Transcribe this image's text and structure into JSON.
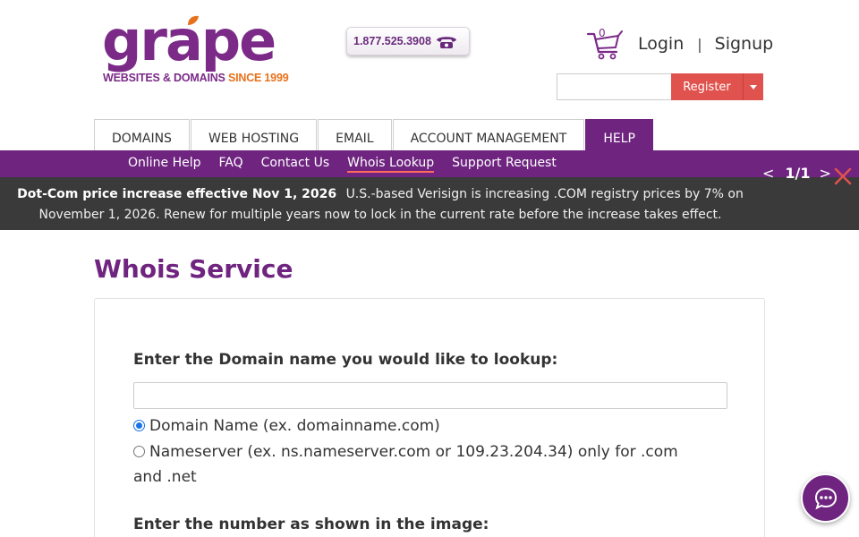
{
  "brand": {
    "logo_word": "grape",
    "tagline_part1": "WEBSITES & DOMAINS",
    "tagline_part2": " SINCE 1999",
    "color_purple": "#7b2a88",
    "color_orange": "#e8711b"
  },
  "header": {
    "phone": "1.877.525.3908",
    "phone_icon": "telephone-icon",
    "cart_count": "0",
    "cart_icon": "shopping-cart-icon",
    "login_label": "Login",
    "separator": "|",
    "signup_label": "Signup",
    "register_input_value": "",
    "register_button_label": "Register",
    "register_accent": "#e0524d"
  },
  "nav": {
    "tabs": [
      {
        "label": "DOMAINS",
        "active": false
      },
      {
        "label": "WEB HOSTING",
        "active": false
      },
      {
        "label": "EMAIL",
        "active": false
      },
      {
        "label": "ACCOUNT MANAGEMENT",
        "active": false
      },
      {
        "label": "HELP",
        "active": true
      }
    ],
    "accent": "#6f2480"
  },
  "subnav": {
    "items": [
      {
        "label": "Online Help",
        "active": false
      },
      {
        "label": "FAQ",
        "active": false
      },
      {
        "label": "Contact Us",
        "active": false
      },
      {
        "label": "Whois Lookup",
        "active": true
      },
      {
        "label": "Support Request",
        "active": false
      }
    ]
  },
  "notice": {
    "headline": "Dot-Com price increase effective Nov 1, 2026",
    "body": "U.S.-based Verisign is increasing .COM registry prices by 7% on November 1, 2026. Renew for multiple years now to lock in the current rate before the increase takes effect.",
    "prev": "<",
    "counter": "1/1",
    "next": ">",
    "close_icon": "close-icon",
    "close_color": "#e0524d"
  },
  "main": {
    "title": "Whois Service",
    "domain_prompt": "Enter the Domain name you would like to lookup:",
    "domain_value": "",
    "options": [
      {
        "label": "Domain Name (ex. domainname.com)",
        "checked": true
      },
      {
        "label": "Nameserver (ex. ns.nameserver.com or 109.23.204.34) only for .com and .net",
        "checked": false
      }
    ],
    "captcha_prompt": "Enter the number as shown in the image:"
  },
  "chat": {
    "icon": "chat-bubble-icon"
  }
}
